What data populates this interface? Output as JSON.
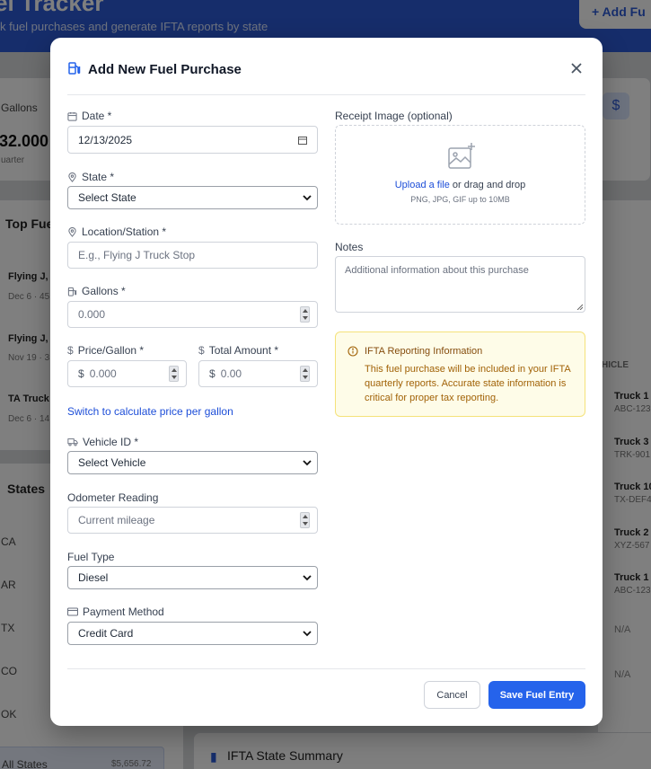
{
  "background": {
    "title": "Fuel Tracker",
    "title_visible": "el Tracker",
    "subtitle": "k fuel purchases and generate IFTA reports by state",
    "add_button": "+ Add Fu",
    "stat_label": "Gallons",
    "stat_value": "32.000",
    "stat_sub": "uarter",
    "top_fuel_title": "Top Fue",
    "top_items": [
      {
        "name": "Flying J, I",
        "meta": "Dec 6 · 45"
      },
      {
        "name": "Flying J, I",
        "meta": "Nov 19 · 3"
      },
      {
        "name": "TA Truck",
        "meta": "Dec 6 · 14"
      }
    ],
    "states_title": "States",
    "states": [
      "CA",
      "AR",
      "TX",
      "CO",
      "OK"
    ],
    "all_states_label": "All States",
    "all_states_value": "$5,656.72",
    "vehicle_col": "HICLE",
    "vehicles": [
      {
        "name": "Truck 1",
        "plate": "ABC-123"
      },
      {
        "name": "Truck 3",
        "plate": "TRK-901"
      },
      {
        "name": "Truck 10",
        "plate": "TX-DEF4"
      },
      {
        "name": "Truck 2",
        "plate": "XYZ-567"
      },
      {
        "name": "Truck 1",
        "plate": "ABC-123"
      },
      {
        "name": "N/A",
        "plate": ""
      },
      {
        "name": "N/A",
        "plate": ""
      }
    ],
    "summary_title": "IFTA State Summary"
  },
  "modal": {
    "title": "Add New Fuel Purchase",
    "date": {
      "label": "Date *",
      "value": "12/13/2025"
    },
    "state": {
      "label": "State *",
      "value": "Select State"
    },
    "location": {
      "label": "Location/Station *",
      "placeholder": "E.g., Flying J Truck Stop"
    },
    "gallons": {
      "label": "Gallons *",
      "placeholder": "0.000"
    },
    "price": {
      "label": "Price/Gallon *",
      "currency": "$",
      "placeholder": "0.000"
    },
    "total": {
      "label": "Total Amount *",
      "currency": "$",
      "placeholder": "0.00"
    },
    "switch_link": "Switch to calculate price per gallon",
    "vehicle": {
      "label": "Vehicle ID *",
      "value": "Select Vehicle"
    },
    "odometer": {
      "label": "Odometer Reading",
      "placeholder": "Current mileage"
    },
    "fuel_type": {
      "label": "Fuel Type",
      "value": "Diesel"
    },
    "payment": {
      "label": "Payment Method",
      "value": "Credit Card"
    },
    "receipt": {
      "label": "Receipt Image (optional)",
      "upload_link": "Upload a file",
      "upload_rest": " or drag and drop",
      "hint": "PNG, JPG, GIF up to 10MB"
    },
    "notes": {
      "label": "Notes",
      "placeholder": "Additional information about this purchase"
    },
    "info": {
      "title": "IFTA Reporting Information",
      "body": "This fuel purchase will be included in your IFTA quarterly reports. Accurate state information is critical for proper tax reporting."
    },
    "cancel_label": "Cancel",
    "save_label": "Save Fuel Entry"
  },
  "colors": {
    "accent": "#2563eb",
    "info_bg": "#fefce8",
    "info_text": "#a16207"
  }
}
